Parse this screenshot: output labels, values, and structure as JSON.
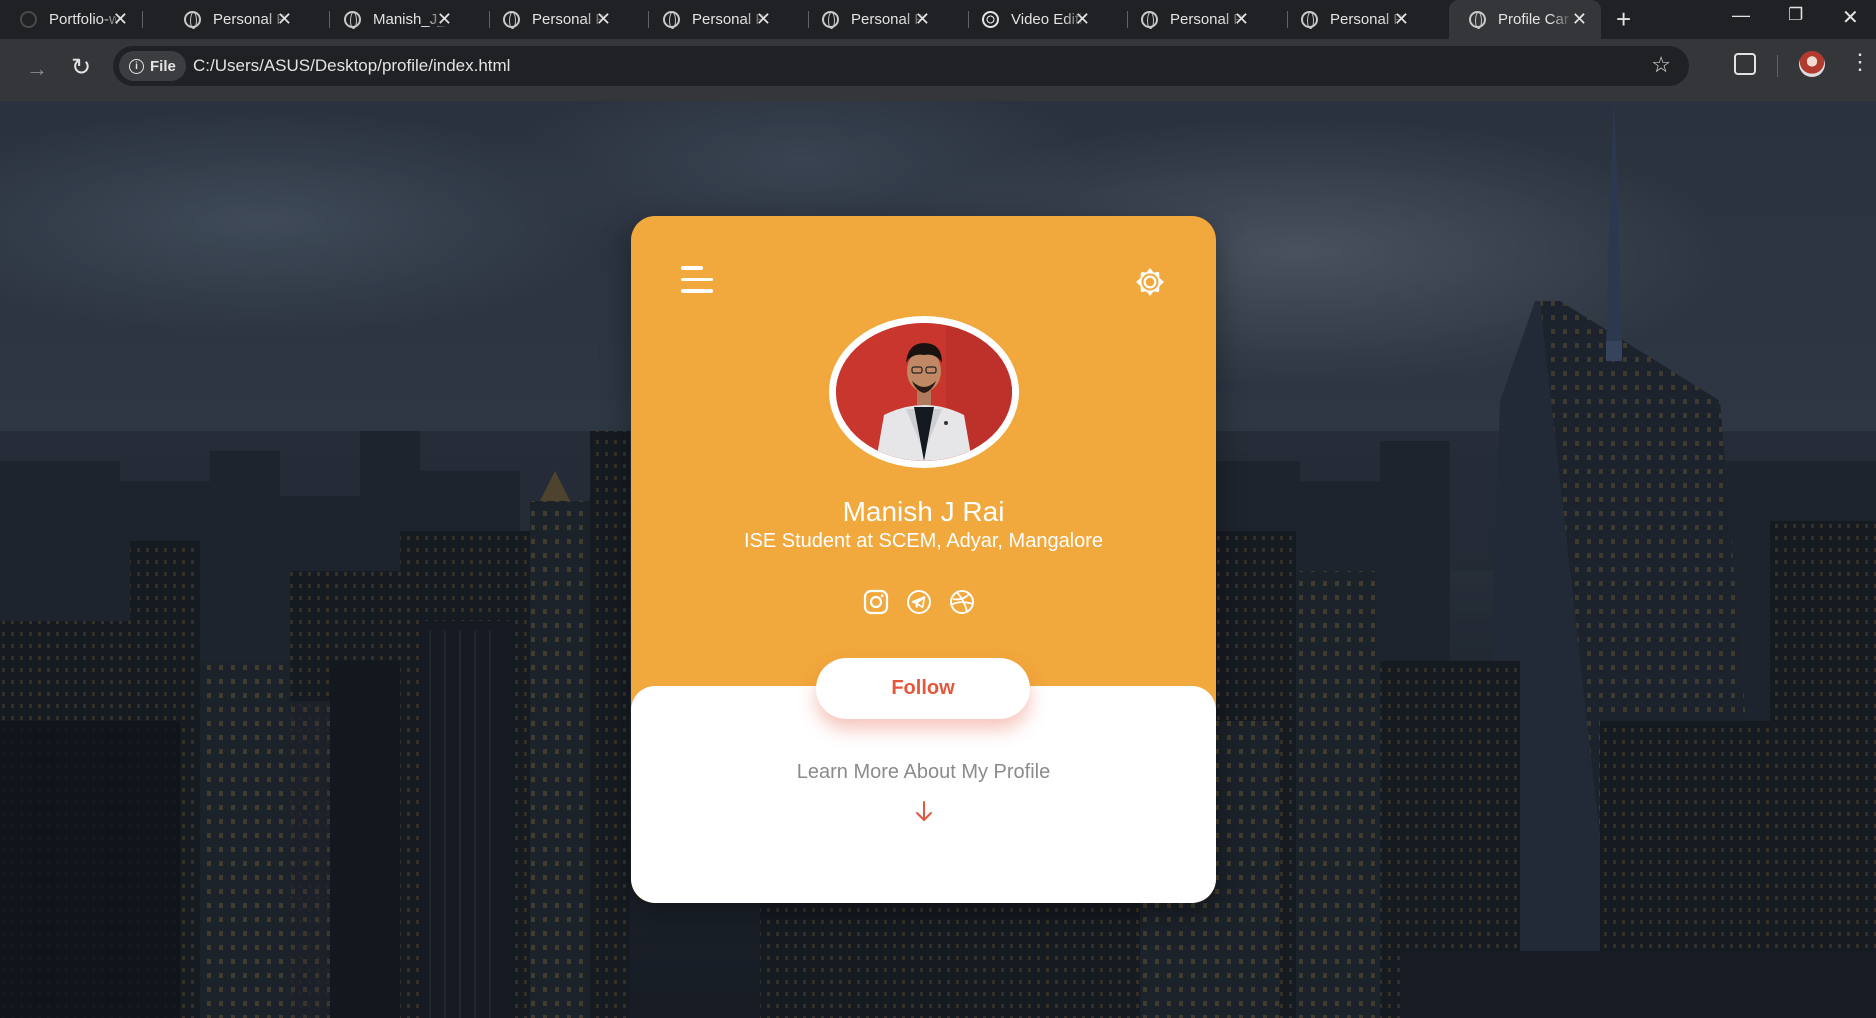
{
  "browser": {
    "tabs": [
      {
        "title": "Portfolio-w",
        "icon": "github-icon"
      },
      {
        "title": "Personal P",
        "icon": "globe-icon"
      },
      {
        "title": "Manish_J_R",
        "icon": "globe-icon"
      },
      {
        "title": "Personal P",
        "icon": "globe-icon"
      },
      {
        "title": "Personal P",
        "icon": "globe-icon"
      },
      {
        "title": "Personal P",
        "icon": "globe-icon"
      },
      {
        "title": "Video Editi",
        "icon": "spiral-icon"
      },
      {
        "title": "Personal P",
        "icon": "globe-icon"
      },
      {
        "title": "Personal P",
        "icon": "globe-icon"
      },
      {
        "title": "Profile Car",
        "icon": "globe-icon",
        "active": true
      }
    ],
    "chip_label": "File",
    "url": "C:/Users/ASUS/Desktop/profile/index.html"
  },
  "card": {
    "name": "Manish J Rai",
    "subtitle": "ISE Student at SCEM, Adyar, Mangalore",
    "socials": [
      "instagram-icon",
      "telegram-icon",
      "dribbble-icon"
    ],
    "follow_label": "Follow",
    "learn_more": "Learn More About My Profile",
    "colors": {
      "accent": "#f1a83c",
      "button_text": "#e4573d",
      "arrow": "#e4573d"
    }
  }
}
